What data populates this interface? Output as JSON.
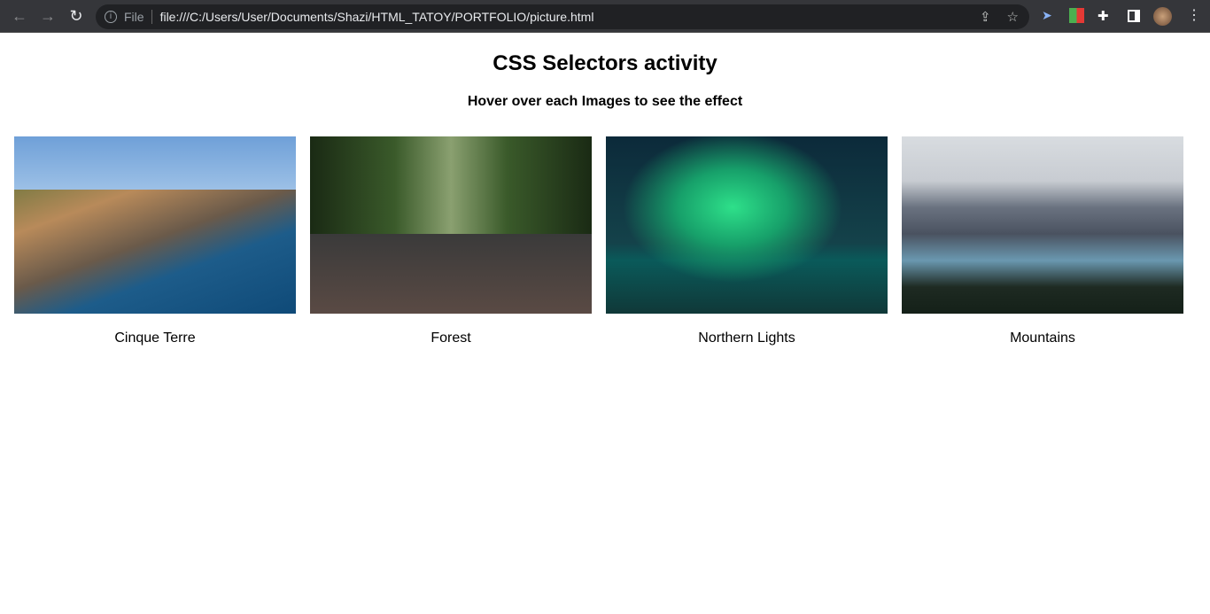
{
  "browser": {
    "file_label": "File",
    "url": "file:///C:/Users/User/Documents/Shazi/HTML_TATOY/PORTFOLIO/picture.html"
  },
  "page": {
    "title": "CSS Selectors activity",
    "subtitle": "Hover over each Images to see the effect"
  },
  "gallery": [
    {
      "caption": "Cinque Terre"
    },
    {
      "caption": "Forest"
    },
    {
      "caption": "Northern Lights"
    },
    {
      "caption": "Mountains"
    }
  ]
}
